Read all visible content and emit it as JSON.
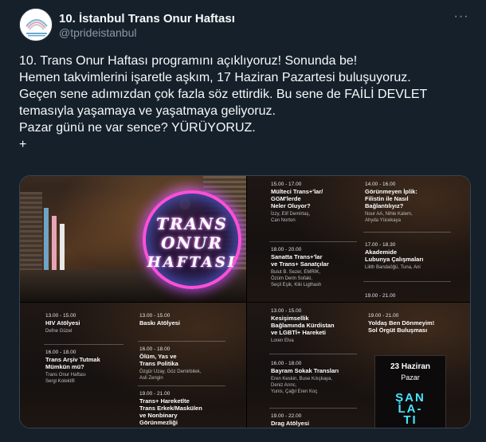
{
  "author": {
    "display_name": "10. İstanbul Trans Onur Haftası",
    "handle": "@tprideistanbul"
  },
  "more_label": "···",
  "tweet_lines": [
    "10. Trans Onur Haftası programını açıklıyoruz! Sonunda be!",
    "Hemen takvimlerini işaretle aşkım, 17 Haziran Pazartesi buluşuyoruz.",
    "Geçen sene adımızdan çok fazla söz ettirdik. Bu sene de FAİLİ DEVLET",
    "temasıyla yaşamaya ve yaşatmaya geliyoruz.",
    "Pazar günü ne var sence? YÜRÜYORUZ.",
    "+"
  ],
  "media": {
    "logo": [
      "TRANS",
      "ONUR",
      "HAFTASI"
    ],
    "panel2_left": [
      {
        "time": "15.00 - 17.00",
        "title": [
          "Mülteci Trans+'lar/",
          "GGM'lerde",
          "Neler Oluyor?"
        ],
        "people": [
          "İzzy, Elif Demirtaş,",
          "Can Norton"
        ]
      },
      {
        "time": "18.00 - 20.00",
        "title": [
          "Sanatta Trans+'lar",
          "ve Trans+ Sanatçılar"
        ],
        "people": [
          "Bulut B. Sezer, EMRİK,",
          "Özüm Derin Sofaki,",
          "Seçil Eşik, Kiki Ligthash"
        ]
      }
    ],
    "panel2_right": [
      {
        "time": "14.00 - 16.00",
        "title": [
          "Görünmeyen İplik:",
          "Filistin ile Nasıl",
          "Bağlantılıyız?"
        ],
        "people": [
          "Nour AA, Nihle Kalem,",
          "Ahyda Yücekaya"
        ]
      },
      {
        "time": "17.00 - 18.30",
        "title": [
          "Akademide",
          "Lubunya Çalışmaları"
        ],
        "people": [
          "Lilith Bandaöğü, Tuna, Ani"
        ]
      },
      {
        "time": "19.00 - 21.00",
        "title": [],
        "people": []
      }
    ],
    "panel3_left": [
      {
        "time": "13.00 - 15.00",
        "title": [
          "HIV Atölyesi"
        ],
        "people": [
          "Defne Güzel"
        ]
      },
      {
        "time": "16.00 - 18.00",
        "title": [
          "Trans Arşiv Tutmak",
          "Mümkün mü?"
        ],
        "people": [
          "Trans Onur Haftası",
          "Sergi Kolektifi"
        ]
      }
    ],
    "panel3_right": [
      {
        "time": "13.00 - 15.00",
        "title": [
          "Baskı Atölyesi"
        ],
        "people": []
      },
      {
        "time": "16.00 - 18.00",
        "title": [
          "Ölüm, Yas ve",
          "Trans Politika"
        ],
        "people": [
          "Özgür Uzay, Göz Demirbilek,",
          "Asli Zengin"
        ]
      },
      {
        "time": "19.00 - 21.00",
        "title": [
          "Trans+ Hareketlte",
          "Trans Erkek/Maskülen",
          "ve Nonbinary",
          "Görünmezliği"
        ],
        "people": []
      }
    ],
    "panel4_left": [
      {
        "time": "13.00 - 15.00",
        "title": [
          "Kesişimsellik",
          "Bağlamında Kürdistan",
          "ve LGBTİ+ Hareketi"
        ],
        "people": [
          "Loren Elva"
        ]
      },
      {
        "time": "16.00 - 18.00",
        "title": [
          "Bayram Sokak Transları"
        ],
        "people": [
          "Eren Keskin, Buse Kılıçkaya,",
          "Deniz Arınc,",
          "Yunis, Çağıl Eren Koç"
        ]
      },
      {
        "time": "19.00 - 22.00",
        "title": [
          "Drag Atölyesi"
        ],
        "people": []
      }
    ],
    "panel4_right": [
      {
        "time": "19.00 - 21.00",
        "title": [
          "Yoldaş Ben Dönmeyim!",
          "Sol Örgüt Buluşması"
        ],
        "people": []
      }
    ],
    "date_card": {
      "date": "23 Haziran",
      "day": "Pazar",
      "word": [
        "ŞAN",
        "LA-",
        "TI"
      ]
    }
  }
}
